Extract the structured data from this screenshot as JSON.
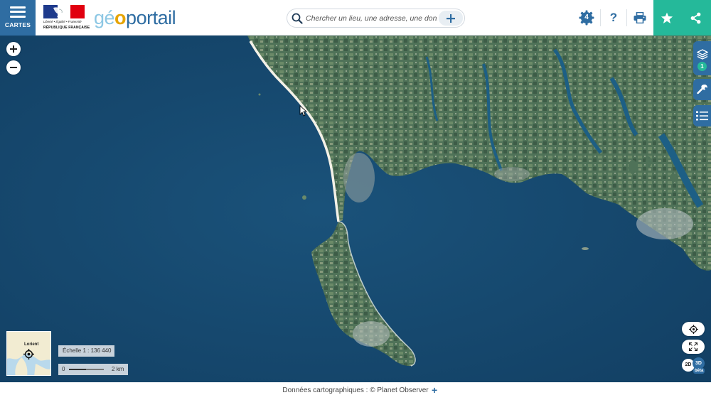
{
  "header": {
    "menu_label": "CARTES",
    "gov_motto": "Liberté • Égalité • Fraternité",
    "gov_name": "RÉPUBLIQUE FRANÇAISE",
    "brand": {
      "part1": "gé",
      "part2": "o",
      "part3": "portail"
    },
    "search": {
      "placeholder": "Chercher un lieu, une adresse, une donnée",
      "value": ""
    },
    "notifications_count": "4",
    "help_label": "?",
    "icons": [
      "menu-icon",
      "search-icon",
      "plus-icon",
      "notification-gear-icon",
      "help-icon",
      "print-icon",
      "star-icon",
      "share-icon"
    ]
  },
  "map": {
    "layer_count": "1",
    "scale_label": "Échelle 1 : 136 440",
    "scale_bar": {
      "min": "0",
      "max": "2 km"
    },
    "overview_town": "Lorient",
    "view_2d": "2D",
    "view_3d": "3D",
    "view_3d_badge": "bêta"
  },
  "footer": {
    "attribution": "Données cartographiques : ©  Planet Observer",
    "more": "+"
  },
  "colors": {
    "primary": "#2f6da2",
    "accent": "#25b99a",
    "sea": "#154a70",
    "land": "#4d6e56"
  }
}
